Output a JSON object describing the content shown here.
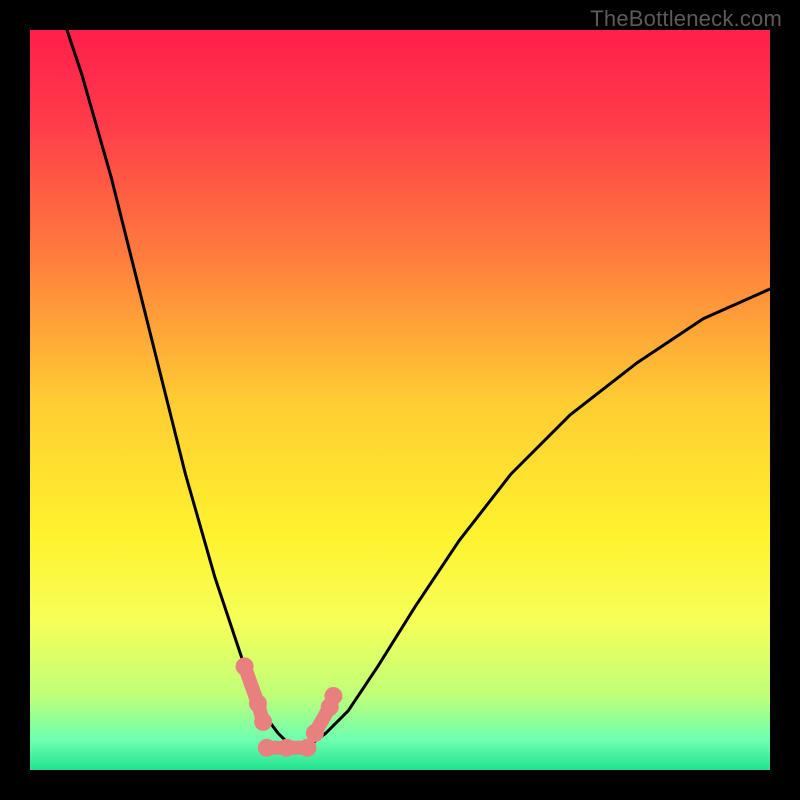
{
  "watermark": "TheBottleneck.com",
  "chart_data": {
    "type": "line",
    "title": "",
    "xlabel": "",
    "ylabel": "",
    "xlim": [
      0,
      100
    ],
    "ylim": [
      0,
      100
    ],
    "grid": false,
    "legend": false,
    "background": {
      "type": "vertical-gradient",
      "stops": [
        {
          "pos": 0.0,
          "color": "#ff1f4c"
        },
        {
          "pos": 0.12,
          "color": "#ff3a4a"
        },
        {
          "pos": 0.3,
          "color": "#ff7a3e"
        },
        {
          "pos": 0.5,
          "color": "#ffcc33"
        },
        {
          "pos": 0.68,
          "color": "#fff22e"
        },
        {
          "pos": 0.8,
          "color": "#f6ff59"
        },
        {
          "pos": 0.9,
          "color": "#beff7a"
        },
        {
          "pos": 0.96,
          "color": "#6dffb0"
        },
        {
          "pos": 1.0,
          "color": "#21e28f"
        }
      ]
    },
    "optimum_x": 34,
    "series": [
      {
        "name": "left-curve",
        "stroke": "#000000",
        "x": [
          5,
          7,
          9,
          11,
          13,
          15,
          17,
          19,
          21,
          23,
          25,
          27,
          29,
          30.5,
          32,
          33.5,
          35
        ],
        "y": [
          100,
          94,
          87,
          80,
          72,
          64,
          56,
          48,
          40,
          33,
          26,
          20,
          14,
          10,
          7,
          5,
          3.5
        ]
      },
      {
        "name": "right-curve",
        "stroke": "#000000",
        "x": [
          38,
          40,
          43,
          47,
          52,
          58,
          65,
          73,
          82,
          91,
          100
        ],
        "y": [
          3.5,
          5,
          8,
          14,
          22,
          31,
          40,
          48,
          55,
          61,
          65
        ]
      }
    ],
    "annotations": {
      "dip_marker": {
        "color": "#e98080",
        "segments": [
          {
            "x1": 29.0,
            "y1": 14.0,
            "x2": 30.8,
            "y2": 9.0
          },
          {
            "x1": 30.8,
            "y1": 9.0,
            "x2": 31.5,
            "y2": 6.5
          },
          {
            "x1": 32.0,
            "y1": 3.0,
            "x2": 37.5,
            "y2": 3.0
          },
          {
            "x1": 38.5,
            "y1": 5.0,
            "x2": 40.5,
            "y2": 8.5
          },
          {
            "x1": 40.5,
            "y1": 8.5,
            "x2": 41.0,
            "y2": 10.0
          }
        ],
        "dots": [
          {
            "x": 29.0,
            "y": 14.0
          },
          {
            "x": 30.8,
            "y": 9.0
          },
          {
            "x": 31.5,
            "y": 6.5
          },
          {
            "x": 32.0,
            "y": 3.0
          },
          {
            "x": 34.7,
            "y": 3.0
          },
          {
            "x": 37.5,
            "y": 3.0
          },
          {
            "x": 38.5,
            "y": 5.0
          },
          {
            "x": 40.5,
            "y": 8.5
          },
          {
            "x": 41.0,
            "y": 10.0
          }
        ]
      }
    }
  }
}
